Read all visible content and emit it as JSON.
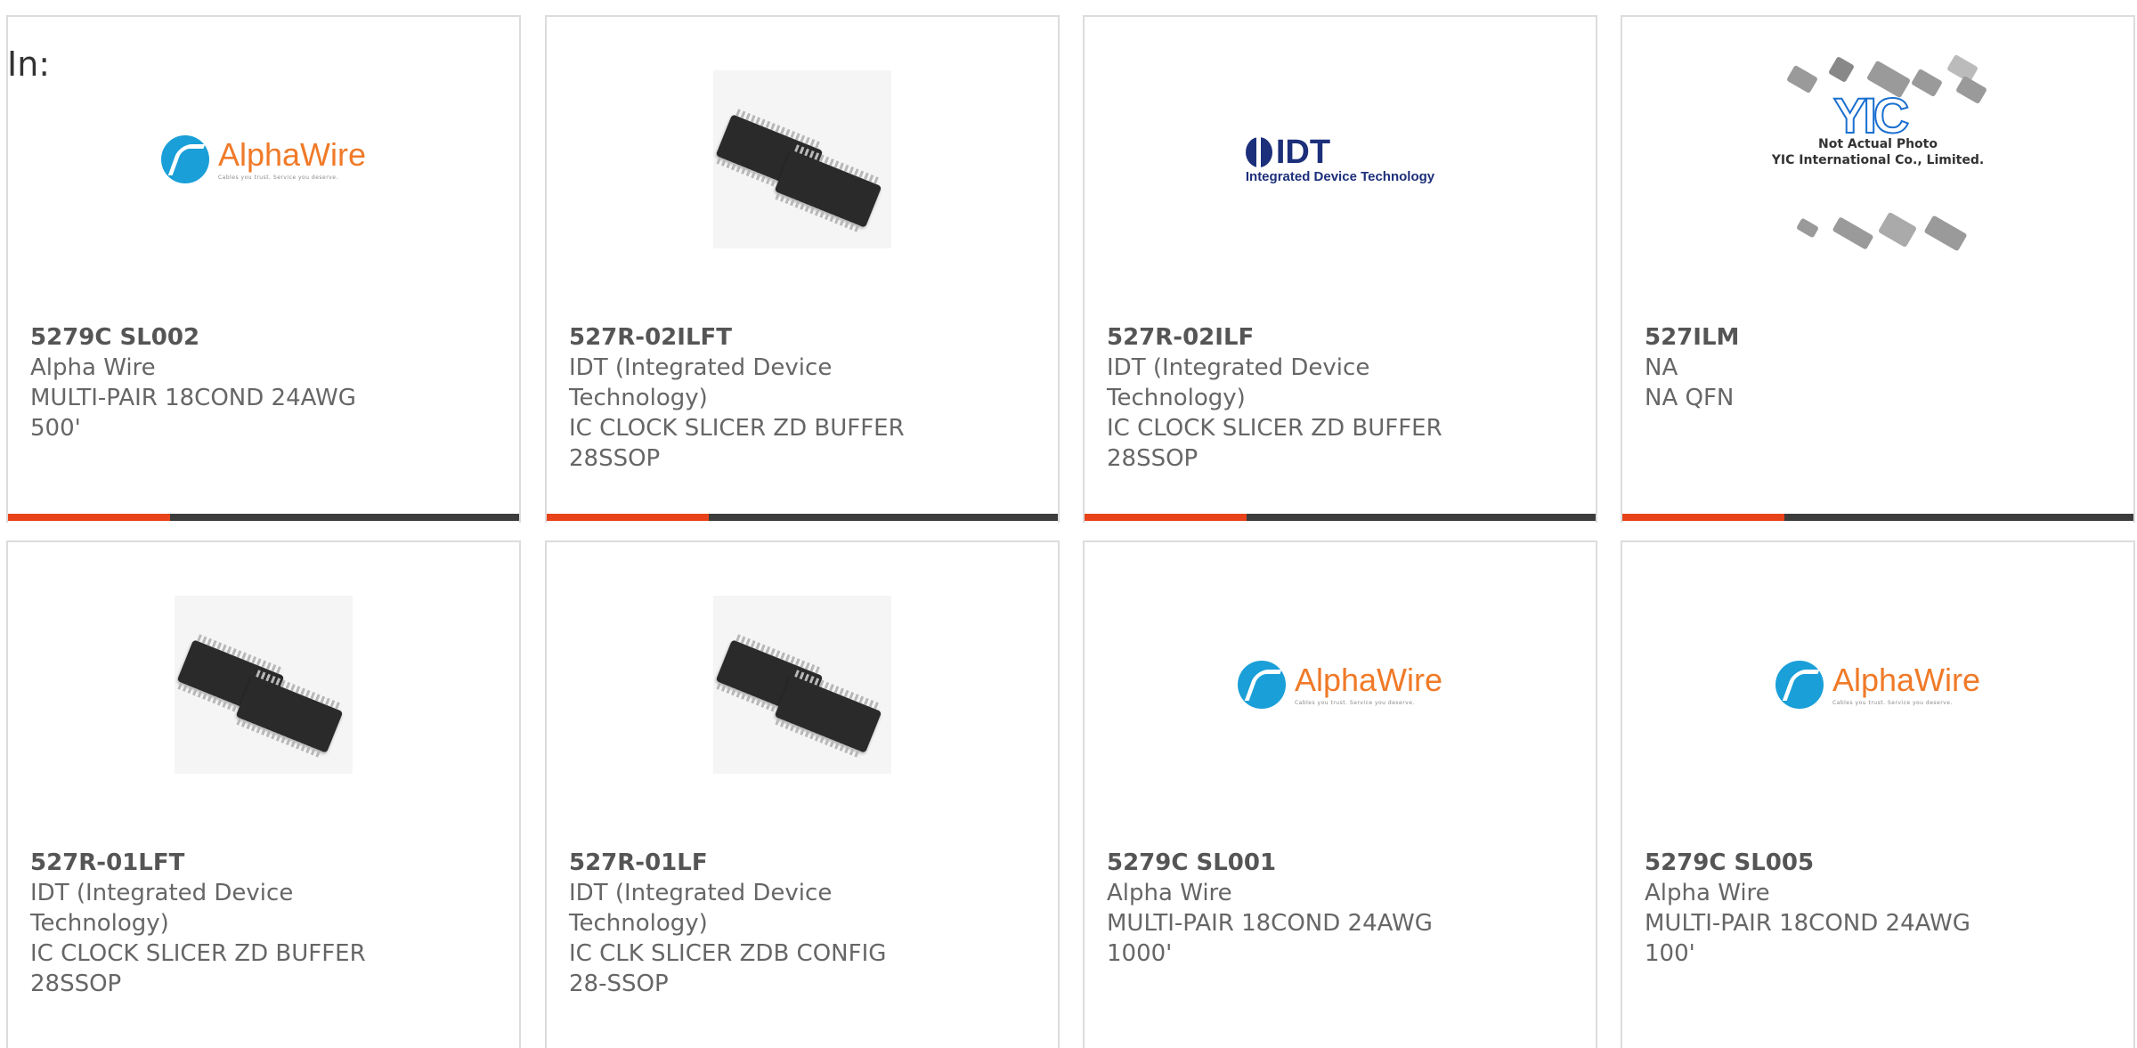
{
  "page": {
    "in_label": "In:"
  },
  "brand": {
    "accent": "#e8421a",
    "bar": "#3c3c3c",
    "alpha_blue": "#1a9fd8",
    "alpha_orange": "#f07a28",
    "idt_blue": "#1c2f7a"
  },
  "logos": {
    "alphawire": {
      "name": "AlphaWire",
      "tagline": "Cables you trust. Service you deserve."
    },
    "idt": {
      "name": "IDT",
      "sub": "Integrated Device Technology"
    },
    "yic": {
      "mark": "YIC",
      "line1": "Not Actual Photo",
      "line2": "YIC International Co., Limited."
    }
  },
  "products": [
    {
      "part": "5279C SL002",
      "mfr": "Alpha Wire",
      "desc": "MULTI-PAIR 18COND 24AWG 500'",
      "image": "alphawire-logo"
    },
    {
      "part": "527R-02ILFT",
      "mfr": "IDT (Integrated Device Technology)",
      "desc": "IC CLOCK SLICER ZD BUFFER 28SSOP",
      "image": "chip-photo"
    },
    {
      "part": "527R-02ILF",
      "mfr": "IDT (Integrated Device Technology)",
      "desc": "IC CLOCK SLICER ZD BUFFER 28SSOP",
      "image": "idt-logo"
    },
    {
      "part": "527ILM",
      "mfr": "NA",
      "desc": "NA QFN",
      "image": "yic-placeholder"
    },
    {
      "part": "527R-01LFT",
      "mfr": "IDT (Integrated Device Technology)",
      "desc": "IC CLOCK SLICER ZD BUFFER 28SSOP",
      "image": "chip-photo"
    },
    {
      "part": "527R-01LF",
      "mfr": "IDT (Integrated Device Technology)",
      "desc": "IC CLK SLICER ZDB CONFIG 28-SSOP",
      "image": "chip-photo"
    },
    {
      "part": "5279C SL001",
      "mfr": "Alpha Wire",
      "desc": "MULTI-PAIR 18COND 24AWG 1000'",
      "image": "alphawire-logo"
    },
    {
      "part": "5279C SL005",
      "mfr": "Alpha Wire",
      "desc": "MULTI-PAIR 18COND 24AWG 100'",
      "image": "alphawire-logo"
    }
  ]
}
